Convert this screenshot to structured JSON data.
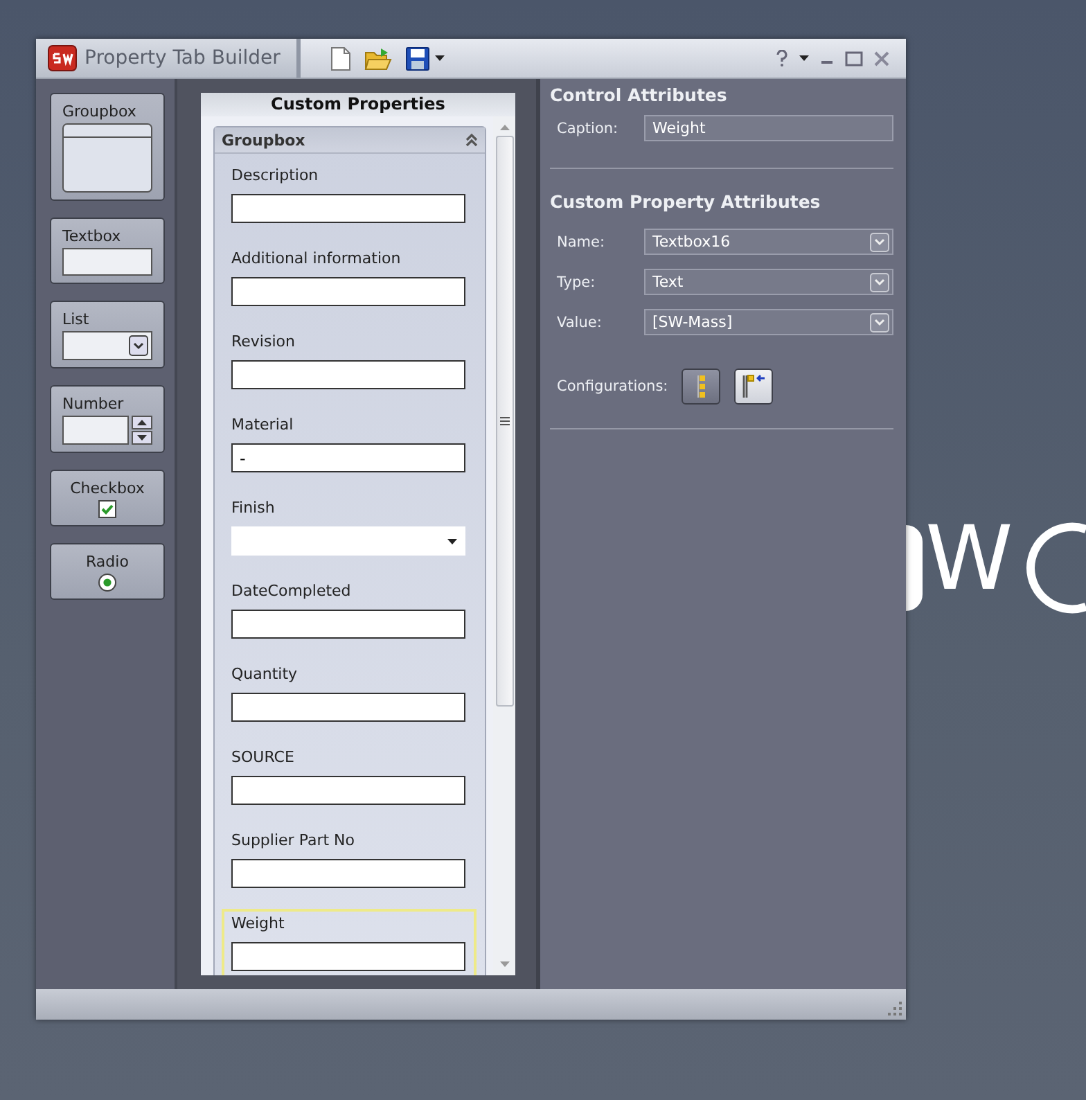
{
  "background_text": "W",
  "window": {
    "title": "Property Tab Builder"
  },
  "palette": [
    {
      "kind": "groupbox",
      "label": "Groupbox"
    },
    {
      "kind": "textbox",
      "label": "Textbox"
    },
    {
      "kind": "list",
      "label": "List"
    },
    {
      "kind": "number",
      "label": "Number"
    },
    {
      "kind": "checkbox",
      "label": "Checkbox",
      "checked": true
    },
    {
      "kind": "radio",
      "label": "Radio",
      "selected": true
    }
  ],
  "preview": {
    "title": "Custom Properties",
    "groupbox": {
      "title": "Groupbox",
      "expanded": true,
      "fields": [
        {
          "label": "Description",
          "kind": "text",
          "selected": false
        },
        {
          "label": "Additional information",
          "kind": "text",
          "selected": false
        },
        {
          "label": "Revision",
          "kind": "text",
          "selected": false
        },
        {
          "label": "Material",
          "kind": "text",
          "value": "-",
          "selected": false
        },
        {
          "label": "Finish",
          "kind": "dropdown",
          "selected": false
        },
        {
          "label": "DateCompleted",
          "kind": "text",
          "selected": false
        },
        {
          "label": "Quantity",
          "kind": "text",
          "selected": false
        },
        {
          "label": "SOURCE",
          "kind": "text",
          "selected": false
        },
        {
          "label": "Supplier Part No",
          "kind": "text",
          "selected": false
        },
        {
          "label": "Weight",
          "kind": "text",
          "selected": true
        }
      ]
    }
  },
  "control_attributes": {
    "title": "Control Attributes",
    "caption_label": "Caption:",
    "caption_value": "Weight"
  },
  "custom_property_attributes": {
    "title": "Custom Property Attributes",
    "rows": [
      {
        "label": "Name:",
        "value": "Textbox16"
      },
      {
        "label": "Type:",
        "value": "Text"
      },
      {
        "label": "Value:",
        "value": "[SW-Mass]"
      }
    ],
    "configurations_label": "Configurations:"
  }
}
